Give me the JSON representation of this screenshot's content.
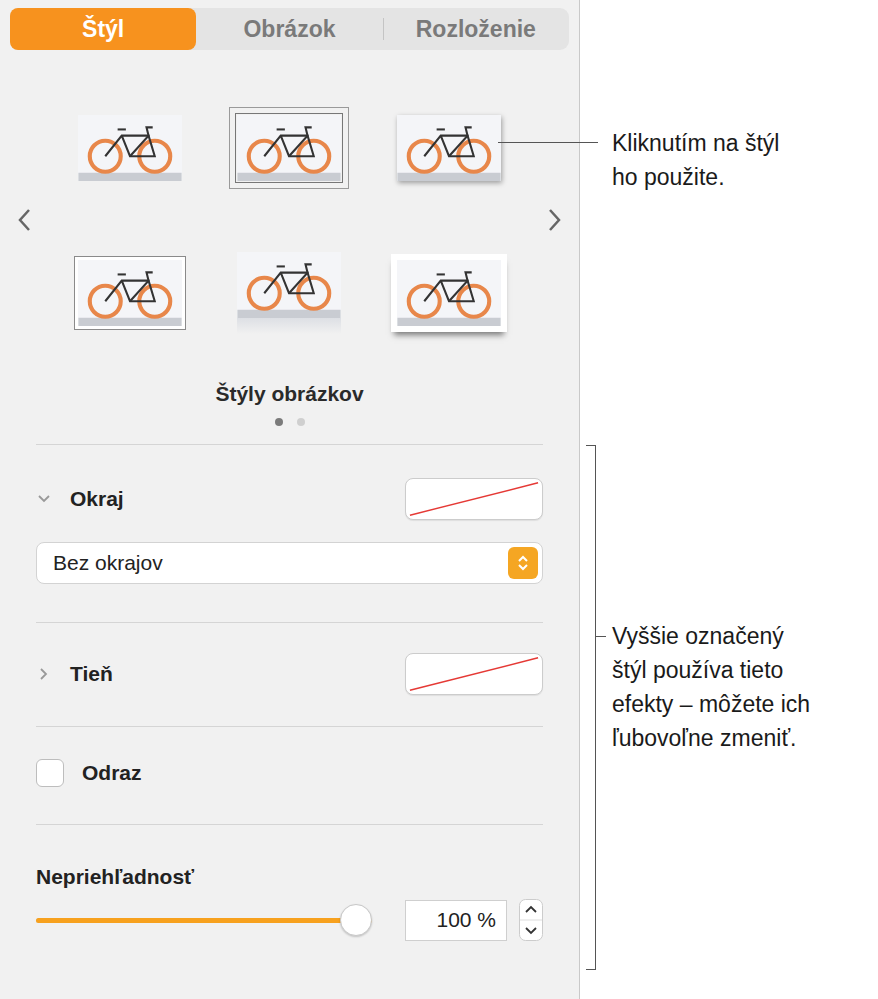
{
  "tabs": [
    {
      "label": "Štýl",
      "selected": true
    },
    {
      "label": "Obrázok",
      "selected": false
    },
    {
      "label": "Rozloženie",
      "selected": false
    }
  ],
  "styles": {
    "items": [
      {
        "kind": "plain",
        "selected": false
      },
      {
        "kind": "thin-border",
        "selected": true
      },
      {
        "kind": "drop-shadow",
        "selected": false
      },
      {
        "kind": "frame",
        "selected": false
      },
      {
        "kind": "reflection",
        "selected": false
      },
      {
        "kind": "curl-shadow",
        "selected": false
      }
    ],
    "caption": "Štýly obrázkov",
    "pages": [
      {
        "selected": true
      },
      {
        "selected": false
      }
    ]
  },
  "border": {
    "label": "Okraj",
    "expanded": true,
    "color": "none",
    "type": "Bez okrajov"
  },
  "shadow": {
    "label": "Tieň",
    "expanded": false,
    "color": "none"
  },
  "reflection": {
    "label": "Odraz",
    "checked": false
  },
  "opacity": {
    "label": "Nepriehľadnosť",
    "level": 1,
    "reading": "100 %"
  },
  "callouts": [
    {
      "lines": [
        "Kliknutím na štýl",
        "ho použite."
      ]
    },
    {
      "lines": [
        "Vyššie označený",
        "štýl používa tieto",
        "efekty – môžete ich",
        "ľubovoľne zmeniť."
      ]
    }
  ]
}
